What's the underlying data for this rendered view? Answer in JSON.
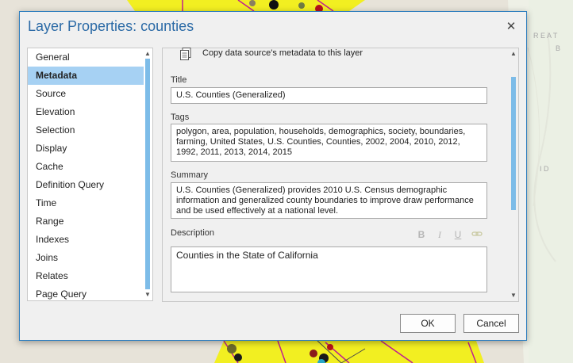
{
  "dialog": {
    "title": "Layer Properties: counties",
    "close_icon": "close-icon"
  },
  "nav": {
    "items": [
      {
        "label": "General",
        "selected": false
      },
      {
        "label": "Metadata",
        "selected": true
      },
      {
        "label": "Source",
        "selected": false
      },
      {
        "label": "Elevation",
        "selected": false
      },
      {
        "label": "Selection",
        "selected": false
      },
      {
        "label": "Display",
        "selected": false
      },
      {
        "label": "Cache",
        "selected": false
      },
      {
        "label": "Definition Query",
        "selected": false
      },
      {
        "label": "Time",
        "selected": false
      },
      {
        "label": "Range",
        "selected": false
      },
      {
        "label": "Indexes",
        "selected": false
      },
      {
        "label": "Joins",
        "selected": false
      },
      {
        "label": "Relates",
        "selected": false
      },
      {
        "label": "Page Query",
        "selected": false
      }
    ]
  },
  "metadata": {
    "copy_label": "Copy data source's metadata to this layer",
    "title_label": "Title",
    "title_value": "U.S. Counties (Generalized)",
    "tags_label": "Tags",
    "tags_value": "polygon, area, population, households, demographics, society, boundaries, farming, United States, U.S. Counties, Counties, 2002, 2004, 2010, 2012, 1992, 2011, 2013, 2014, 2015",
    "summary_label": "Summary",
    "summary_value": "U.S. Counties (Generalized) provides 2010 U.S. Census demographic information and generalized county boundaries to improve draw performance and be used effectively at a national level.",
    "description_label": "Description",
    "description_value": "Counties in the State of California",
    "format_icons": [
      "bold-icon",
      "italic-icon",
      "underline-icon",
      "link-icon"
    ]
  },
  "buttons": {
    "ok": "OK",
    "cancel": "Cancel"
  },
  "map_labels": [
    "R E A T",
    "B",
    "I D"
  ],
  "colors": {
    "accent": "#2b6aa6",
    "selection": "#a6d1f3",
    "county_fill": "#f2ef21",
    "county_border": "#c0208f"
  }
}
